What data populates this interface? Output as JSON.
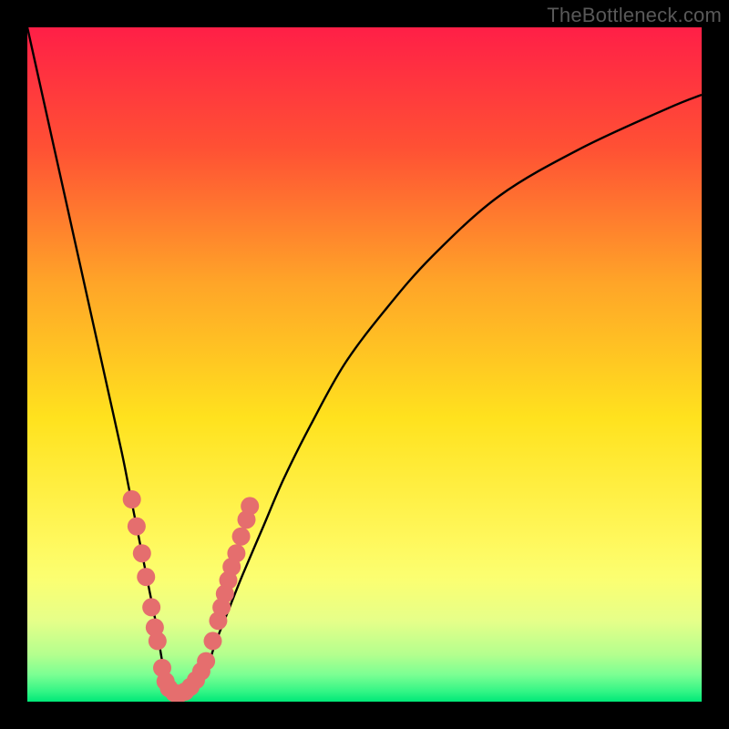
{
  "watermark": "TheBottleneck.com",
  "chart_data": {
    "type": "line",
    "title": "",
    "xlabel": "",
    "ylabel": "",
    "xlim": [
      0,
      100
    ],
    "ylim": [
      0,
      100
    ],
    "grid": false,
    "legend": false,
    "background_gradient_stops": [
      {
        "offset": 0.0,
        "color": "#ff1f47"
      },
      {
        "offset": 0.18,
        "color": "#ff5134"
      },
      {
        "offset": 0.38,
        "color": "#ffa528"
      },
      {
        "offset": 0.58,
        "color": "#ffe21e"
      },
      {
        "offset": 0.76,
        "color": "#fff85c"
      },
      {
        "offset": 0.82,
        "color": "#fbff72"
      },
      {
        "offset": 0.88,
        "color": "#e6ff89"
      },
      {
        "offset": 0.93,
        "color": "#b4ff8e"
      },
      {
        "offset": 0.96,
        "color": "#7bff93"
      },
      {
        "offset": 0.985,
        "color": "#33f585"
      },
      {
        "offset": 1.0,
        "color": "#00e878"
      }
    ],
    "series": [
      {
        "name": "curve",
        "color": "#000000",
        "x": [
          0,
          2,
          4,
          6,
          8,
          10,
          12,
          14,
          15,
          16,
          17,
          18,
          19,
          19.5,
          20,
          20.5,
          21,
          21.5,
          22,
          22.5,
          23,
          24,
          25,
          26,
          27,
          28,
          30,
          32,
          35,
          38,
          42,
          47,
          53,
          60,
          70,
          82,
          95,
          100
        ],
        "y": [
          100,
          91,
          82,
          73,
          64,
          55,
          46,
          37,
          32,
          27,
          22,
          17,
          12,
          9,
          6,
          4,
          2.5,
          1.5,
          1,
          1,
          1,
          1.5,
          2.5,
          4,
          6,
          9,
          14,
          19,
          26,
          33,
          41,
          50,
          58,
          66,
          75,
          82,
          88,
          90
        ]
      }
    ],
    "scatter": {
      "name": "markers",
      "color": "#e56e6e",
      "radius": 10,
      "points": [
        {
          "x": 15.5,
          "y": 30
        },
        {
          "x": 16.2,
          "y": 26
        },
        {
          "x": 17.0,
          "y": 22
        },
        {
          "x": 17.6,
          "y": 18.5
        },
        {
          "x": 18.4,
          "y": 14
        },
        {
          "x": 18.9,
          "y": 11
        },
        {
          "x": 19.3,
          "y": 9
        },
        {
          "x": 20.0,
          "y": 5
        },
        {
          "x": 20.5,
          "y": 3
        },
        {
          "x": 21.0,
          "y": 2
        },
        {
          "x": 21.8,
          "y": 1.3
        },
        {
          "x": 22.6,
          "y": 1.2
        },
        {
          "x": 23.4,
          "y": 1.5
        },
        {
          "x": 24.2,
          "y": 2.2
        },
        {
          "x": 25.0,
          "y": 3.2
        },
        {
          "x": 25.8,
          "y": 4.5
        },
        {
          "x": 26.5,
          "y": 6
        },
        {
          "x": 27.5,
          "y": 9
        },
        {
          "x": 28.3,
          "y": 12
        },
        {
          "x": 28.8,
          "y": 14
        },
        {
          "x": 29.3,
          "y": 16
        },
        {
          "x": 29.8,
          "y": 18
        },
        {
          "x": 30.3,
          "y": 20
        },
        {
          "x": 31.0,
          "y": 22
        },
        {
          "x": 31.7,
          "y": 24.5
        },
        {
          "x": 32.5,
          "y": 27
        },
        {
          "x": 33.0,
          "y": 29
        }
      ]
    }
  }
}
